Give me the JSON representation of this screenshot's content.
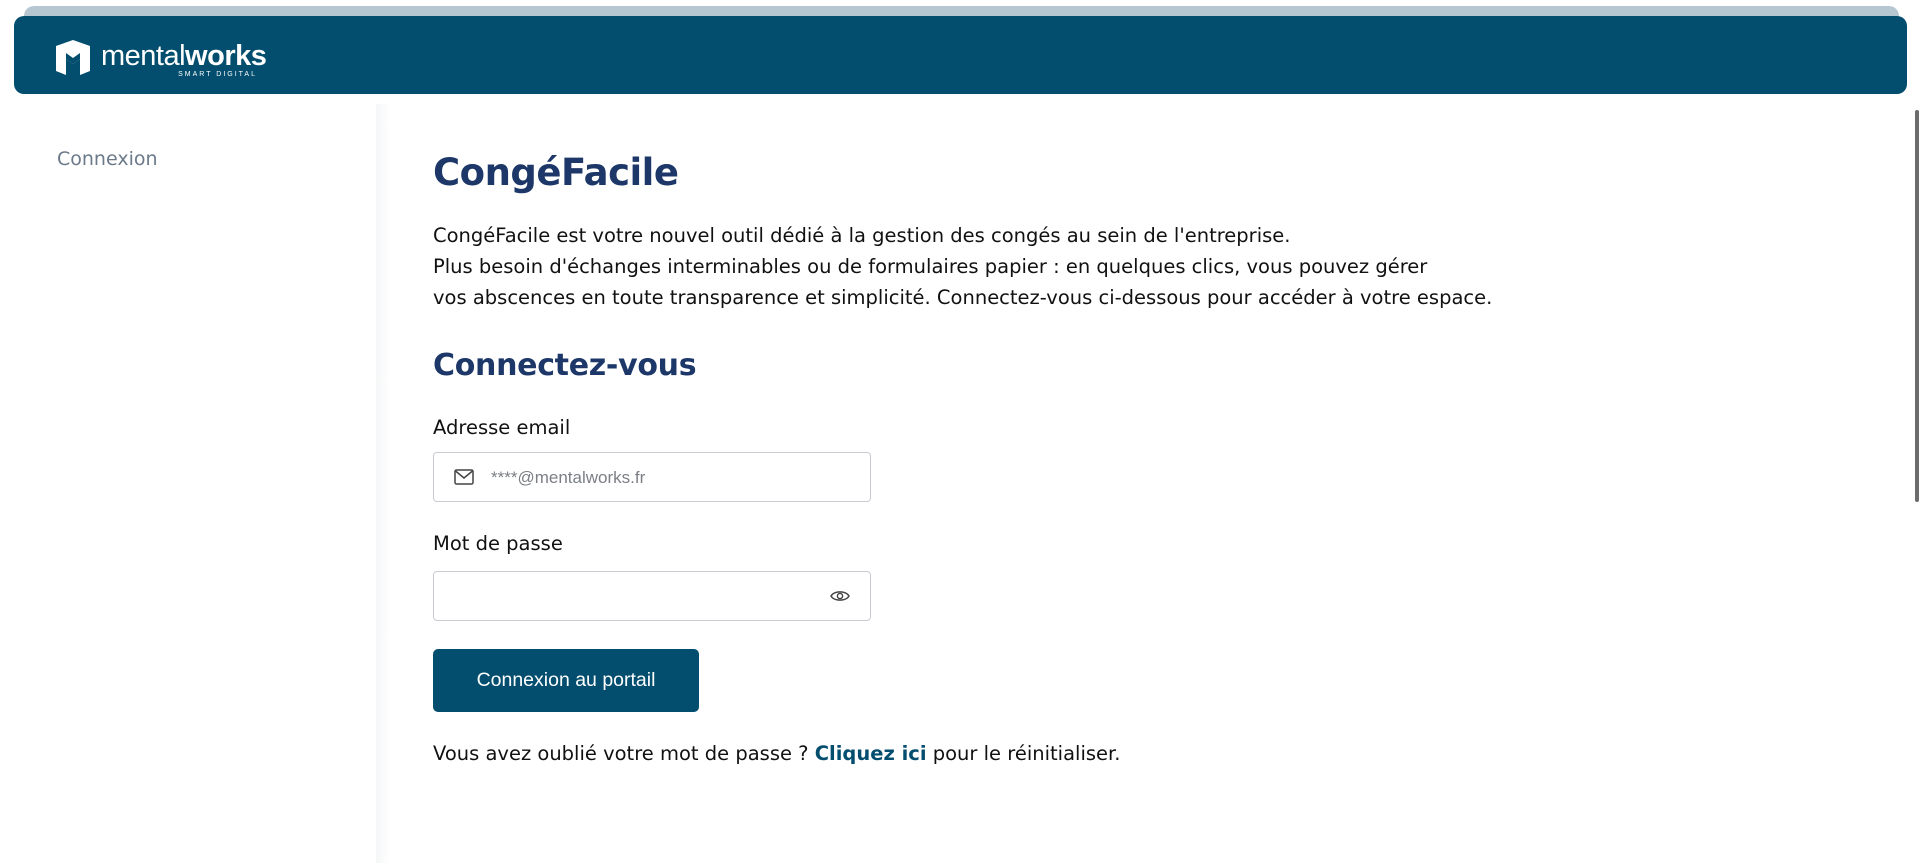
{
  "header": {
    "brand_light": "mental",
    "brand_bold": "works",
    "brand_tagline": "SMART DIGITAL",
    "background_color": "#034e6e"
  },
  "sidebar": {
    "items": [
      {
        "label": "Connexion"
      }
    ]
  },
  "main": {
    "title": "CongéFacile",
    "intro_lines": [
      "CongéFacile est votre nouvel outil dédié à la gestion des congés au sein de l'entreprise.",
      "Plus besoin d'échanges interminables ou de formulaires papier : en quelques clics, vous pouvez gérer",
      "vos abscences en toute transparence et simplicité. Connectez-vous ci-dessous pour accéder à votre espace."
    ],
    "login_title": "Connectez-vous",
    "email": {
      "label": "Adresse email",
      "placeholder": "****@mentalworks.fr",
      "value": "",
      "icon": "mail-icon"
    },
    "password": {
      "label": "Mot de passe",
      "value": "",
      "icon": "eye-icon"
    },
    "submit_label": "Connexion au portail",
    "forgot": {
      "prefix": "Vous avez oublié votre mot de passe ? ",
      "link": "Cliquez ici",
      "suffix": " pour le réinitialiser."
    }
  },
  "colors": {
    "primary": "#034e6e",
    "heading": "#1d3768",
    "sidebar_text": "#6b7a8a"
  }
}
